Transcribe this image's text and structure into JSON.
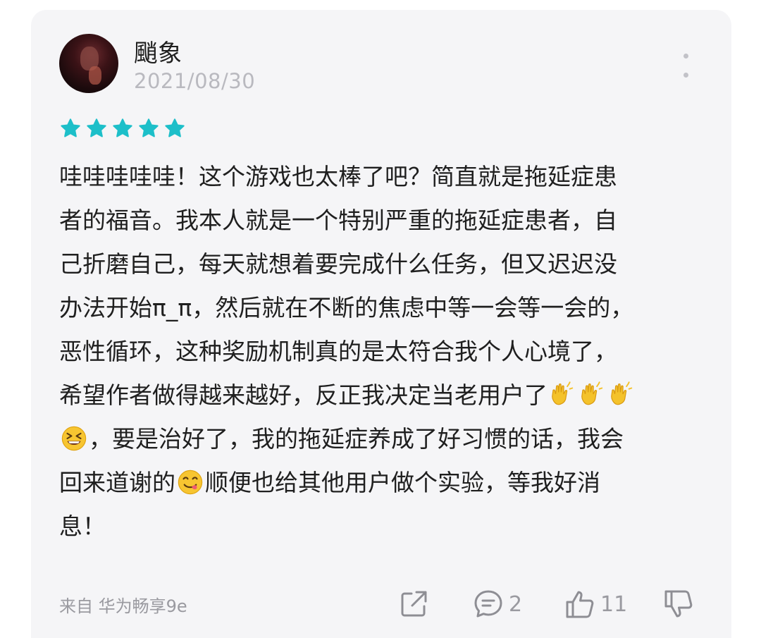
{
  "review": {
    "username": "颵象",
    "date": "2021/08/30",
    "rating": 5,
    "rating_color": "#1dbfc9",
    "lines": [
      "哇哇哇哇哇！这个游戏也太棒了吧？简直就是拖延症患",
      "者的福音。我本人就是一个特别严重的拖延症患者，自",
      "己折磨自己，每天就想着要完成什么任务，但又迟迟没",
      "办法开始π_π，然后就在不断的焦虑中等一会等一会的，",
      "恶性循环，这种奖励机制真的是太符合我个人心境了，",
      "希望作者做得越来越好，反正我决定当老用户了",
      "，要是治好了，我的拖延症养成了好习惯的话，我会",
      "回来道谢的",
      "顺便也给其他用户做个实验，等我好消",
      "息！"
    ],
    "emojis": [
      "clapping-hands",
      "clapping-hands",
      "clapping-hands",
      "grinning-squinting-face",
      "face-savoring-food"
    ],
    "source": "来自 华为畅享9e",
    "comment_count": "2",
    "like_count": "11"
  }
}
